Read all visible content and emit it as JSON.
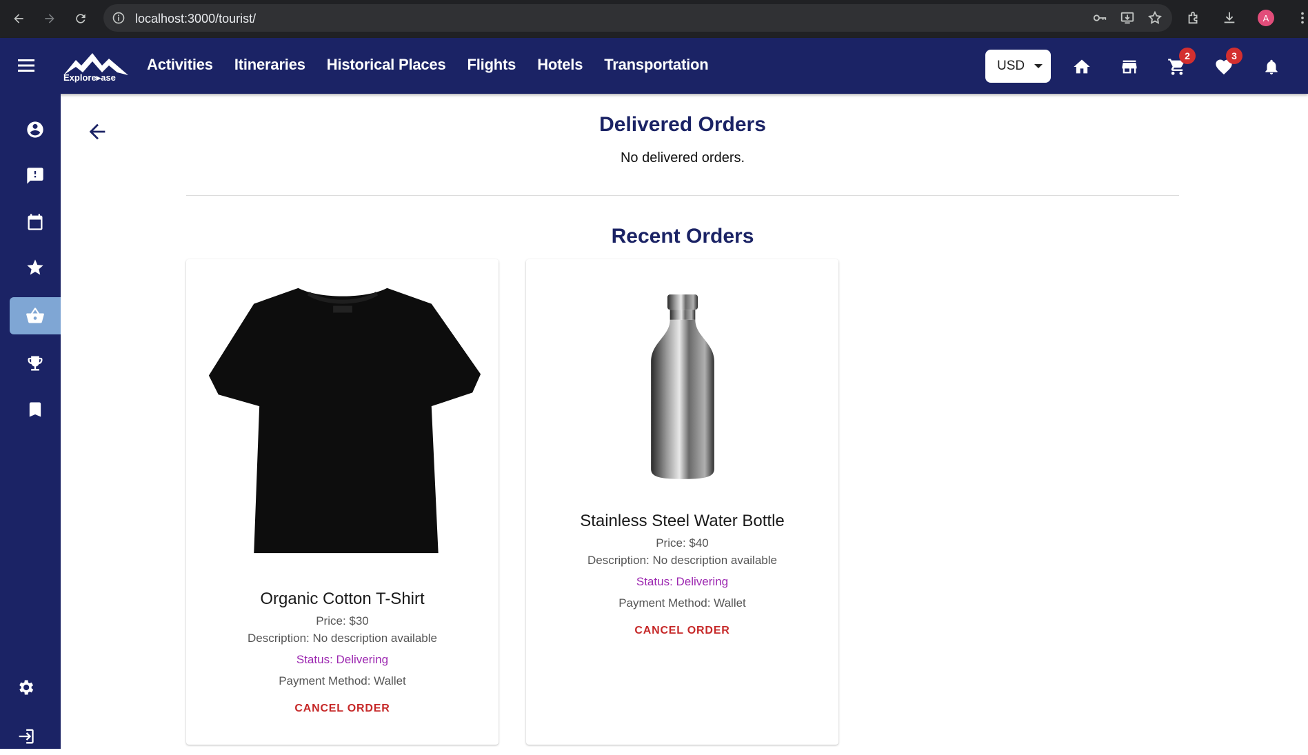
{
  "browser": {
    "url": "localhost:3000/tourist/",
    "profile_initial": "A"
  },
  "header": {
    "logo_text": "Explore▸ase",
    "nav": [
      "Activities",
      "Itineraries",
      "Historical Places",
      "Flights",
      "Hotels",
      "Transportation"
    ],
    "currency": "USD",
    "cart_count": "2",
    "wishlist_count": "3"
  },
  "sidebar": {
    "items": [
      "profile-icon",
      "complaint-icon",
      "calendar-icon",
      "star-icon",
      "basket-icon",
      "trophy-icon",
      "bookmark-icon"
    ],
    "bottom_items": [
      "settings-icon",
      "logout-icon"
    ],
    "active": "basket-icon"
  },
  "delivered": {
    "title": "Delivered Orders",
    "empty_text": "No delivered orders."
  },
  "recent": {
    "title": "Recent Orders",
    "orders": [
      {
        "name": "Organic Cotton T-Shirt",
        "price": "Price: $30",
        "description": "Description: No description available",
        "status": "Status: Delivering",
        "payment": "Payment Method: Wallet",
        "action": "CANCEL ORDER",
        "image": "tshirt-image"
      },
      {
        "name": "Stainless Steel Water Bottle",
        "price": "Price: $40",
        "description": "Description: No description available",
        "status": "Status: Delivering",
        "payment": "Payment Method: Wallet",
        "action": "CANCEL ORDER",
        "image": "bottle-image"
      }
    ]
  },
  "colors": {
    "navy": "#1b2365",
    "active_sidebar": "#7fa6d4",
    "status": "#9c27b0",
    "cancel": "#c62828",
    "badge": "#d32f2f"
  }
}
